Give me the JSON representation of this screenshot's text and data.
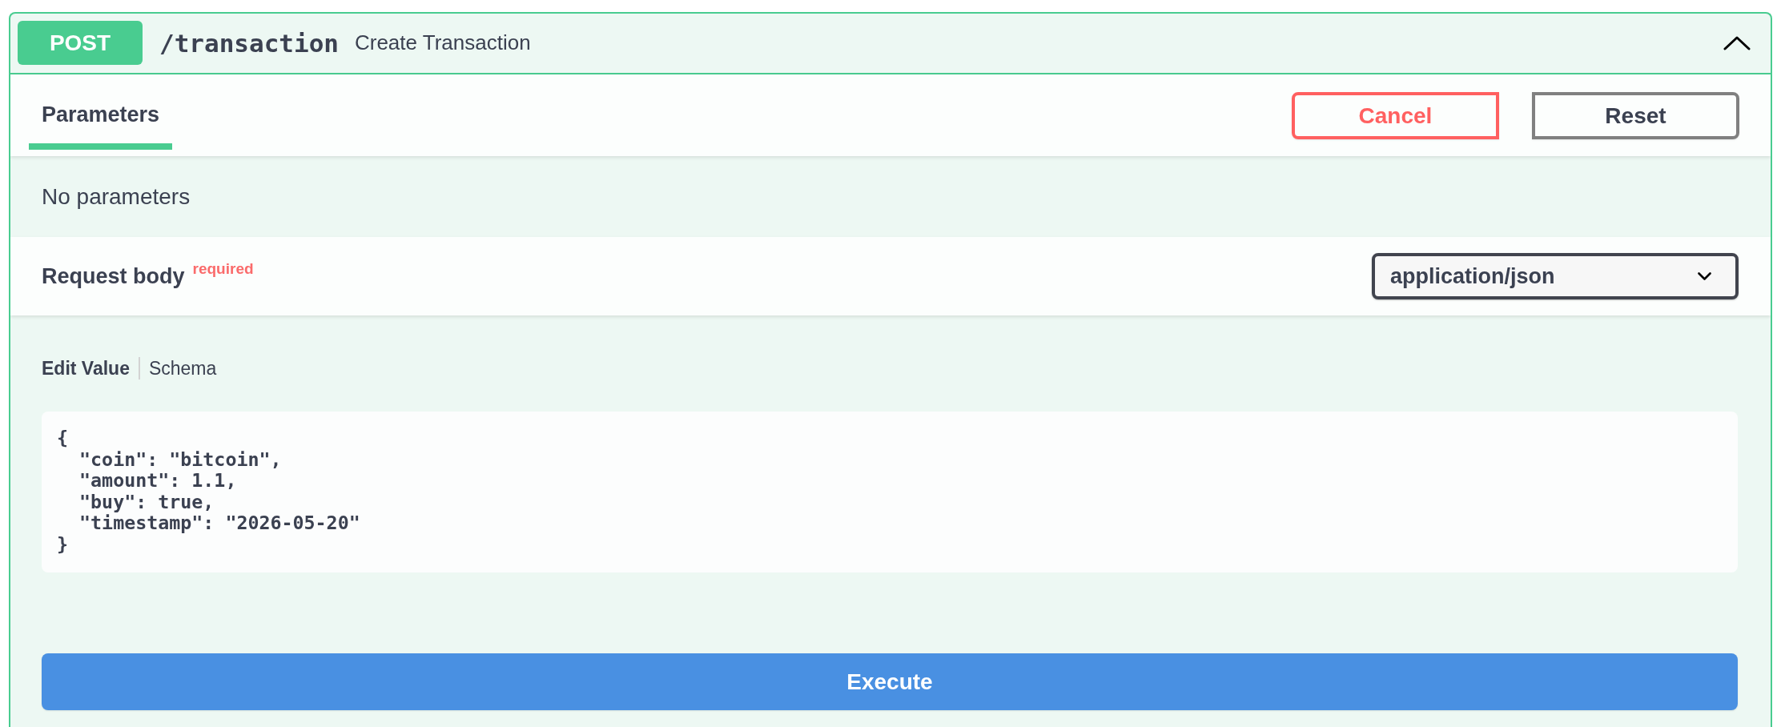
{
  "operation": {
    "method": "POST",
    "path": "/transaction",
    "summary": "Create Transaction",
    "expanded": true
  },
  "tabs": [
    {
      "label": "Parameters",
      "selected": true
    }
  ],
  "buttons": [
    {
      "label": "Cancel",
      "kind": "cancel"
    },
    {
      "label": "Reset",
      "kind": "reset"
    }
  ],
  "parameters": {
    "message": "No parameters"
  },
  "request_body": {
    "title": "Request body",
    "required_label": "required",
    "content_type": "application/json",
    "editor_tabs": [
      {
        "label": "Edit Value",
        "selected": true
      },
      {
        "label": "Schema",
        "selected": false
      }
    ],
    "value": "{\n  \"coin\": \"bitcoin\",\n  \"amount\": 1.1,\n  \"buy\": true,\n  \"timestamp\": \"2026-05-20\"\n}"
  },
  "execute": {
    "label": "Execute"
  }
}
